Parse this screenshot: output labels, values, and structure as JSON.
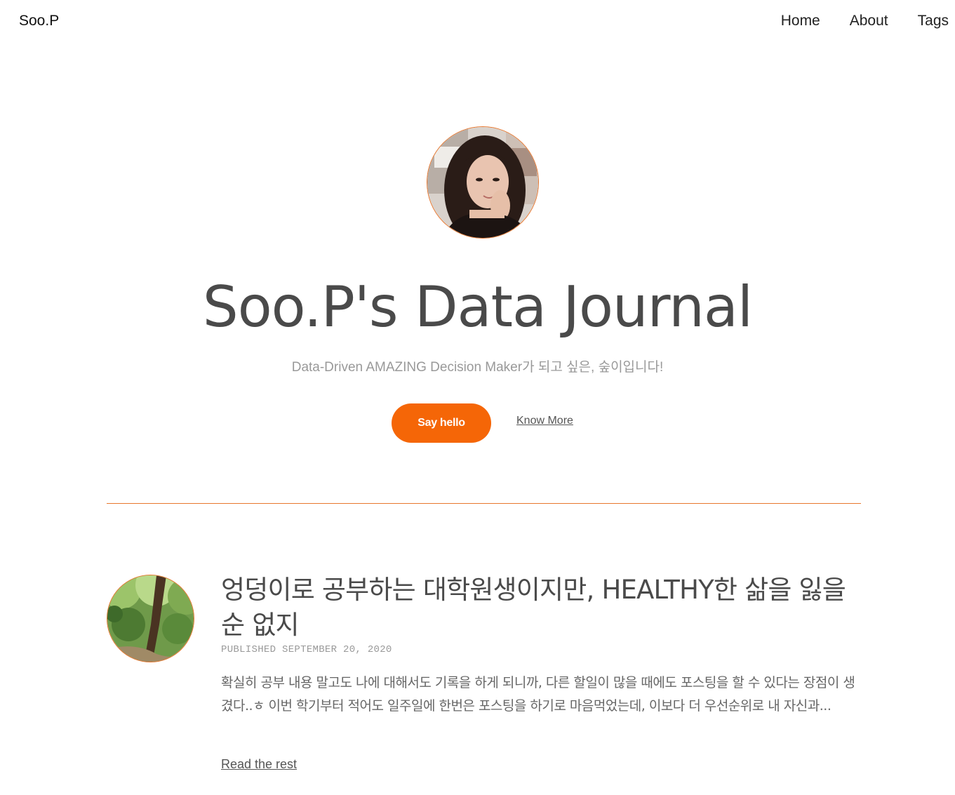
{
  "header": {
    "brand": "Soo.P",
    "nav": [
      "Home",
      "About",
      "Tags"
    ]
  },
  "hero": {
    "title": "Soo.P's Data Journal",
    "subtitle": "Data-Driven AMAZING Decision Maker가 되고 싶은, 숲이입니다!",
    "primary_button": "Say hello",
    "secondary_link": "Know More"
  },
  "colors": {
    "accent": "#f56607",
    "border_accent": "#e8772e",
    "title_text": "#4a4a4a",
    "muted_text": "#999999"
  },
  "posts": [
    {
      "title": "엉덩이로 공부하는 대학원생이지만, HEALTHY한 삶을 잃을 순 없지",
      "meta": "PUBLISHED SEPTEMBER 20, 2020",
      "excerpt": "확실히 공부 내용 말고도 나에 대해서도 기록을 하게 되니까, 다른 할일이 많을 때에도 포스팅을 할 수 있다는 장점이 생겼다..ㅎ 이번 학기부터 적어도 일주일에 한번은 포스팅을 하기로 마음먹었는데, 이보다 더 우선순위로 내 자신과...",
      "read_more": "Read the rest"
    }
  ]
}
